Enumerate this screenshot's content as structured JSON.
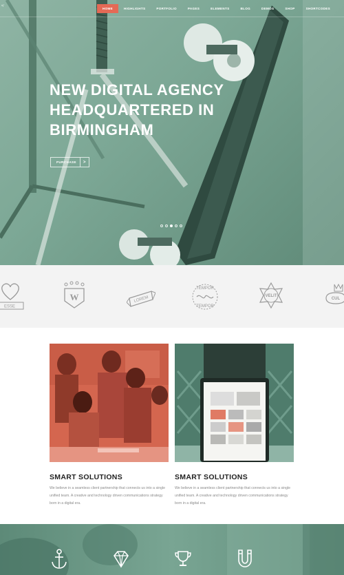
{
  "nav": {
    "items": [
      {
        "label": "HOME",
        "active": true
      },
      {
        "label": "HIGHLIGHTS",
        "active": false
      },
      {
        "label": "PORTFOLIO",
        "active": false
      },
      {
        "label": "PAGES",
        "active": false
      },
      {
        "label": "ELEMENTS",
        "active": false
      },
      {
        "label": "BLOG",
        "active": false
      },
      {
        "label": "DEMOS",
        "active": false
      },
      {
        "label": "SHOP",
        "active": false
      },
      {
        "label": "SHORTCODES",
        "active": false
      }
    ]
  },
  "hero": {
    "title_lines": [
      "NEW DIGITAL AGENCY",
      "HEADQUARTERED IN",
      "BIRMINGHAM"
    ],
    "button_label": "PURCHASE",
    "button_arrow": ">",
    "slides": 5,
    "active_slide": 3
  },
  "logos": {
    "items": [
      {
        "name": "heart-logo",
        "text": "ESSE"
      },
      {
        "name": "w-crest-logo",
        "text": "W"
      },
      {
        "name": "lorem-ribbon-logo",
        "text": "LOREM"
      },
      {
        "name": "tempor-seal-logo",
        "text": "TEMPOR"
      },
      {
        "name": "velit-badge-logo",
        "text": "VELIT"
      },
      {
        "name": "cul-crown-logo",
        "text": "CUL"
      }
    ]
  },
  "cards": [
    {
      "title": "SMART SOLUTIONS",
      "text": "We believe in a seamless client partnership that connects us into a single unified team. A creative and technology driven communications strategy born in a digital era."
    },
    {
      "title": "SMART SOLUTIONS",
      "text": "We believe in a seamless client partnership that connects us into a single unified team. A creative and technology driven communications strategy born in a digital era."
    }
  ],
  "band": {
    "icons": [
      "anchor-icon",
      "diamond-icon",
      "trophy-icon",
      "magnet-icon"
    ]
  },
  "colors": {
    "accent": "#e46a56",
    "hero_tint": "#7da896",
    "strip_bg": "#f3f3f3"
  }
}
